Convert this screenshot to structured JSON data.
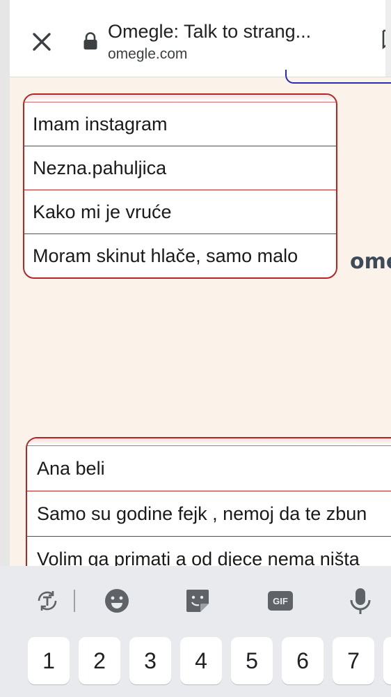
{
  "browser": {
    "title": "Omegle: Talk to strang...",
    "url": "omegle.com"
  },
  "messages_group_1": [
    "Imam instagram",
    "Nezna.pahuljica",
    "Kako mi je vruće",
    "Moram skinut hlače, samo malo"
  ],
  "brand_partial": "ome",
  "messages_group_2": [
    "Ana beli",
    "Samo su godine fejk , nemoj da te zbun",
    "Volim ga primati a od djece nema ništa"
  ],
  "keyboard": {
    "toolbar": [
      "text-scan-icon",
      "emoji-icon",
      "sticker-icon",
      "gif-icon",
      "microphone-icon"
    ],
    "gif_label": "GIF",
    "number_keys": [
      "1",
      "2",
      "3",
      "4",
      "5",
      "6",
      "7"
    ]
  },
  "colors": {
    "card_border": "#b52525",
    "page_background": "#fbf3ea",
    "keyboard_background": "#e8eaed"
  }
}
